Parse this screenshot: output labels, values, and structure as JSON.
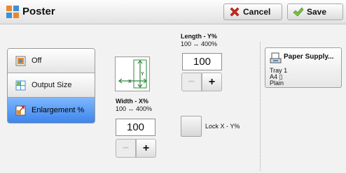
{
  "header": {
    "title": "Poster",
    "cancel_label": "Cancel",
    "save_label": "Save"
  },
  "tabs": [
    {
      "label": "Off",
      "selected": false
    },
    {
      "label": "Output Size",
      "selected": false
    },
    {
      "label": "Enlargement %",
      "selected": true
    }
  ],
  "diagram": {
    "axis_x": "X",
    "axis_y": "Y"
  },
  "length": {
    "label": "Length - Y%",
    "range": "100 ↔ 400%",
    "value": "100"
  },
  "width": {
    "label": "Width - X%",
    "range": "100 ↔ 400%",
    "value": "100"
  },
  "stepper": {
    "minus": "−",
    "plus": "+"
  },
  "lock": {
    "label": "Lock X - Y%"
  },
  "paper_supply": {
    "title": "Paper Supply...",
    "tray": "Tray 1",
    "size": "A4 ▯",
    "type": "Plain"
  },
  "colors": {
    "accent_selected": "#4a8ef0",
    "cancel_icon": "#d0241b",
    "save_icon": "#5aa13a"
  }
}
